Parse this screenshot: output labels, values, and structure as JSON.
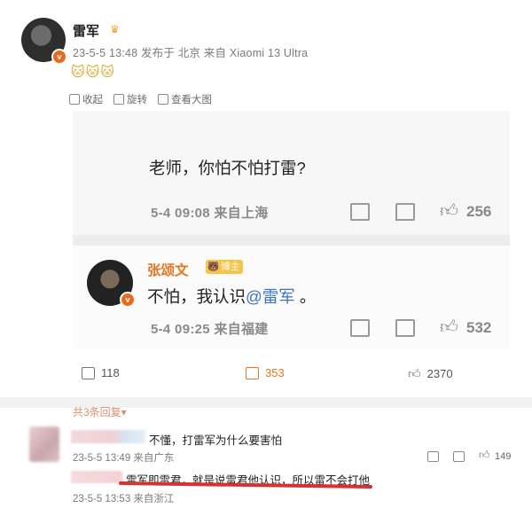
{
  "post": {
    "author": "雷军",
    "meta": "23-5-5 13:48 发布于 北京 来自 Xiaomi 13 Ultra",
    "emojis": "🐱🐱🐱",
    "actions": [
      {
        "label": "收起",
        "icon": "collapse-icon"
      },
      {
        "label": "旋转",
        "icon": "rotate-icon"
      },
      {
        "label": "查看大图",
        "icon": "view-image-icon"
      }
    ]
  },
  "screenshot": {
    "question": {
      "text": "老师，你怕不怕打雷?",
      "meta": "5-4 09:08 来自上海",
      "likes": "256"
    },
    "reply": {
      "author": "张颂文",
      "badge": "博主",
      "text_prefix": "不怕，我认识",
      "mention": "@雷军",
      "text_suffix": " 。",
      "meta": "5-4 09:25 来自福建",
      "likes": "532"
    }
  },
  "footer": {
    "shares": "118",
    "comments": "353",
    "likes": "2370"
  },
  "comments": {
    "replies_toggle": "共3条回复▾",
    "items": [
      {
        "text": "不懂，打雷军为什么要害怕",
        "meta": "23-5-5 13:49 来自广东",
        "likes": "149"
      },
      {
        "text": "雷军即雷君，就是说雷君他认识，所以雷不会打他",
        "meta": "23-5-5 13:53 来自浙江"
      }
    ]
  },
  "colors": {
    "accent_orange": "#e8741b",
    "mention_blue": "#3b73c5",
    "underline_red": "#d63232"
  }
}
